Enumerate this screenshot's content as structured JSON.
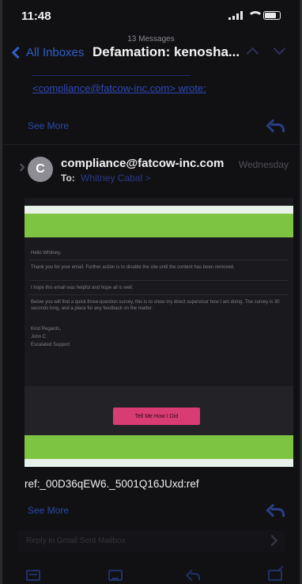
{
  "status_bar": {
    "time": "11:48"
  },
  "nav": {
    "message_count": "13 Messages",
    "back_label": "All Inboxes",
    "title": "Defamation: kenosha..."
  },
  "quoted": {
    "text": "<compliance@fatcow-inc.com> wrote:",
    "see_more": "See More"
  },
  "message": {
    "avatar_initial": "C",
    "sender": "compliance@fatcow-inc.com",
    "date": "Wednesday",
    "to_label": "To:",
    "to_name": "Whitney Cabal >",
    "body": {
      "greeting": "Hello Whitney,",
      "p1": "Thank you for your email. Further action is to disable the site until the content has been removed.",
      "p2": "I hope this email was helpful and hope all is well.",
      "p3": "Below you will find a quick three-question survey, this is to show my direct supervisor how I am doing. The survey is 30 seconds long, and a place for any feedback on the matter.",
      "closing": "Kind Regards,",
      "name": "John C.",
      "team": "Escalated Support",
      "cta_label": "Tell Me How I Did"
    },
    "ref": "ref:_00D36qEW6._5001Q16JUxd:ref",
    "see_more": "See More"
  },
  "reply": {
    "placeholder": "Reply in Gmail Sent Mailbox"
  },
  "colors": {
    "accent": "#2f5fc9",
    "banner_green": "#7dc443",
    "cta_pink": "#d93b73"
  }
}
